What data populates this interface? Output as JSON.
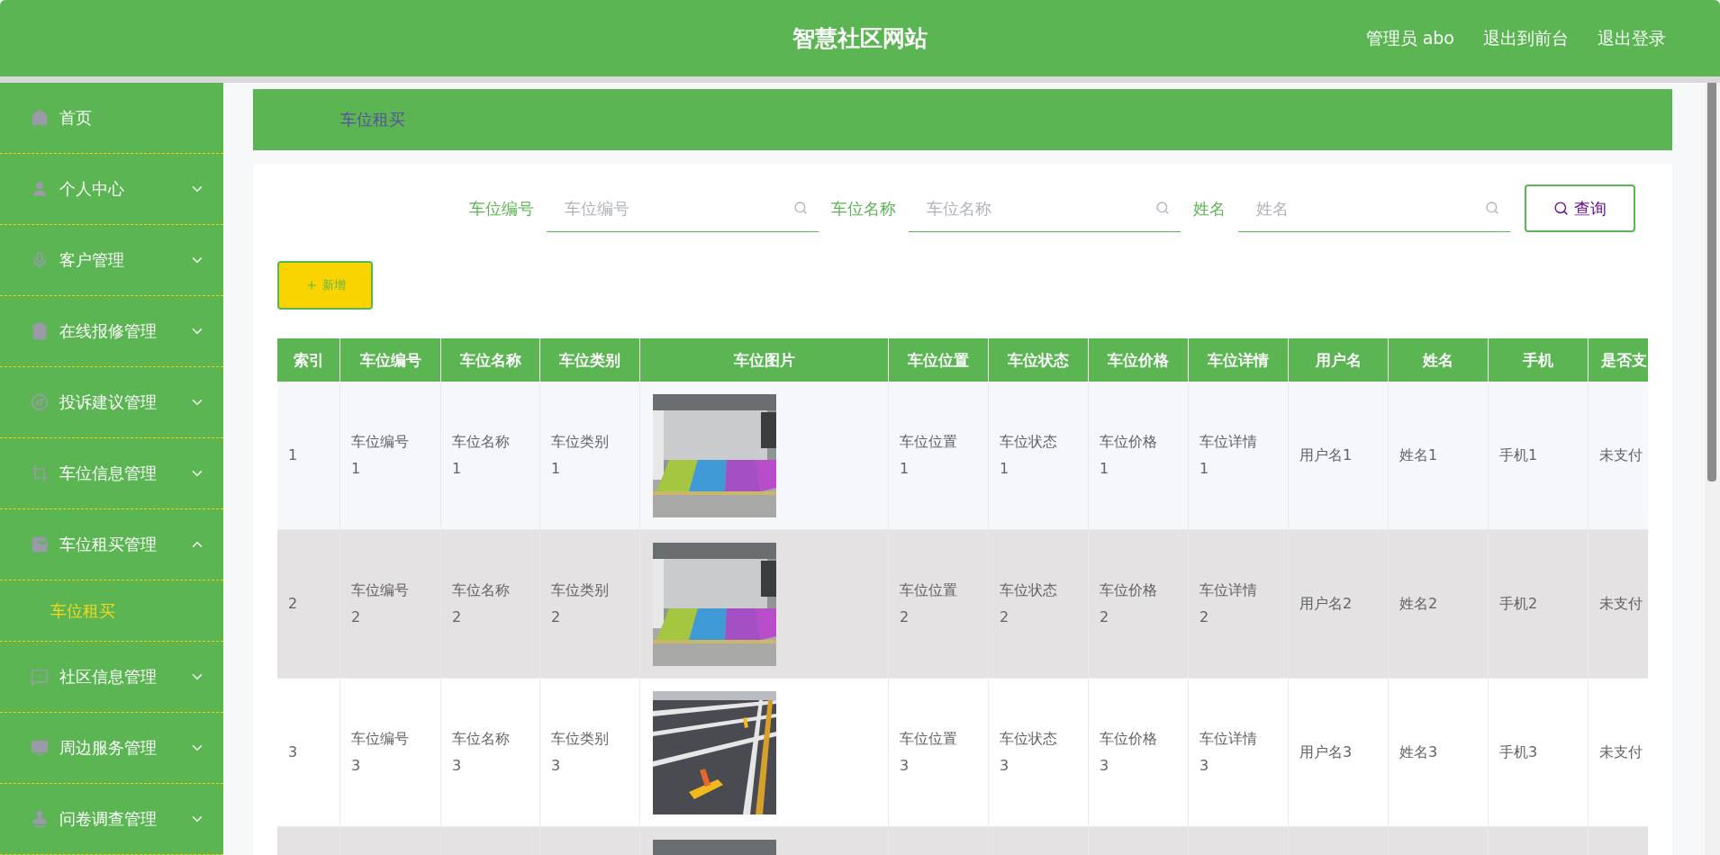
{
  "header": {
    "title": "智慧社区网站",
    "links": [
      "管理员 abo",
      "退出到前台",
      "退出登录"
    ]
  },
  "sidebar": {
    "items": [
      {
        "label": "首页"
      },
      {
        "label": "个人中心",
        "expanded": false
      },
      {
        "label": "客户管理",
        "expanded": false
      },
      {
        "label": "在线报修管理",
        "expanded": false
      },
      {
        "label": "投诉建议管理",
        "expanded": false
      },
      {
        "label": "车位信息管理",
        "expanded": false
      },
      {
        "label": "车位租买管理",
        "expanded": true,
        "children": [
          {
            "label": "车位租买",
            "selected": true
          }
        ]
      },
      {
        "label": "社区信息管理",
        "expanded": false
      },
      {
        "label": "周边服务管理",
        "expanded": false
      },
      {
        "label": "问卷调查管理",
        "expanded": false
      }
    ]
  },
  "breadcrumb": "车位租买",
  "search": {
    "fields": [
      {
        "label": "车位编号",
        "placeholder": "车位编号"
      },
      {
        "label": "车位名称",
        "placeholder": "车位名称"
      },
      {
        "label": "姓名",
        "placeholder": "姓名"
      }
    ],
    "button": "查询"
  },
  "add_button": "新增",
  "table": {
    "columns": [
      "索引",
      "车位编号",
      "车位名称",
      "车位类别",
      "车位图片",
      "车位位置",
      "车位状态",
      "车位价格",
      "车位详情",
      "用户名",
      "姓名",
      "手机",
      "是否支"
    ],
    "rows": [
      {
        "picture": {
          "kind": "picture"
        },
        "cells": [
          "1",
          "车位编号1",
          "车位名称1",
          "车位类别1",
          "车位位置1",
          "车位状态1",
          "车位价格1",
          "车位详情1",
          "用户名1",
          "姓名1",
          "手机1",
          "未支付"
        ]
      },
      {
        "picture": {
          "kind": "picture"
        },
        "cells": [
          "2",
          "车位编号2",
          "车位名称2",
          "车位类别2",
          "车位位置2",
          "车位状态2",
          "车位价格2",
          "车位详情2",
          "用户名2",
          "姓名2",
          "手机2",
          "未支付"
        ]
      },
      {
        "picture": {
          "kind": "picture"
        },
        "cells": [
          "3",
          "车位编号3",
          "车位名称3",
          "车位类别3",
          "车位位置3",
          "车位状态3",
          "车位价格3",
          "车位详情3",
          "用户名3",
          "姓名3",
          "手机3",
          "未支付"
        ]
      },
      {
        "picture": {
          "kind": "picture"
        }
      }
    ]
  }
}
